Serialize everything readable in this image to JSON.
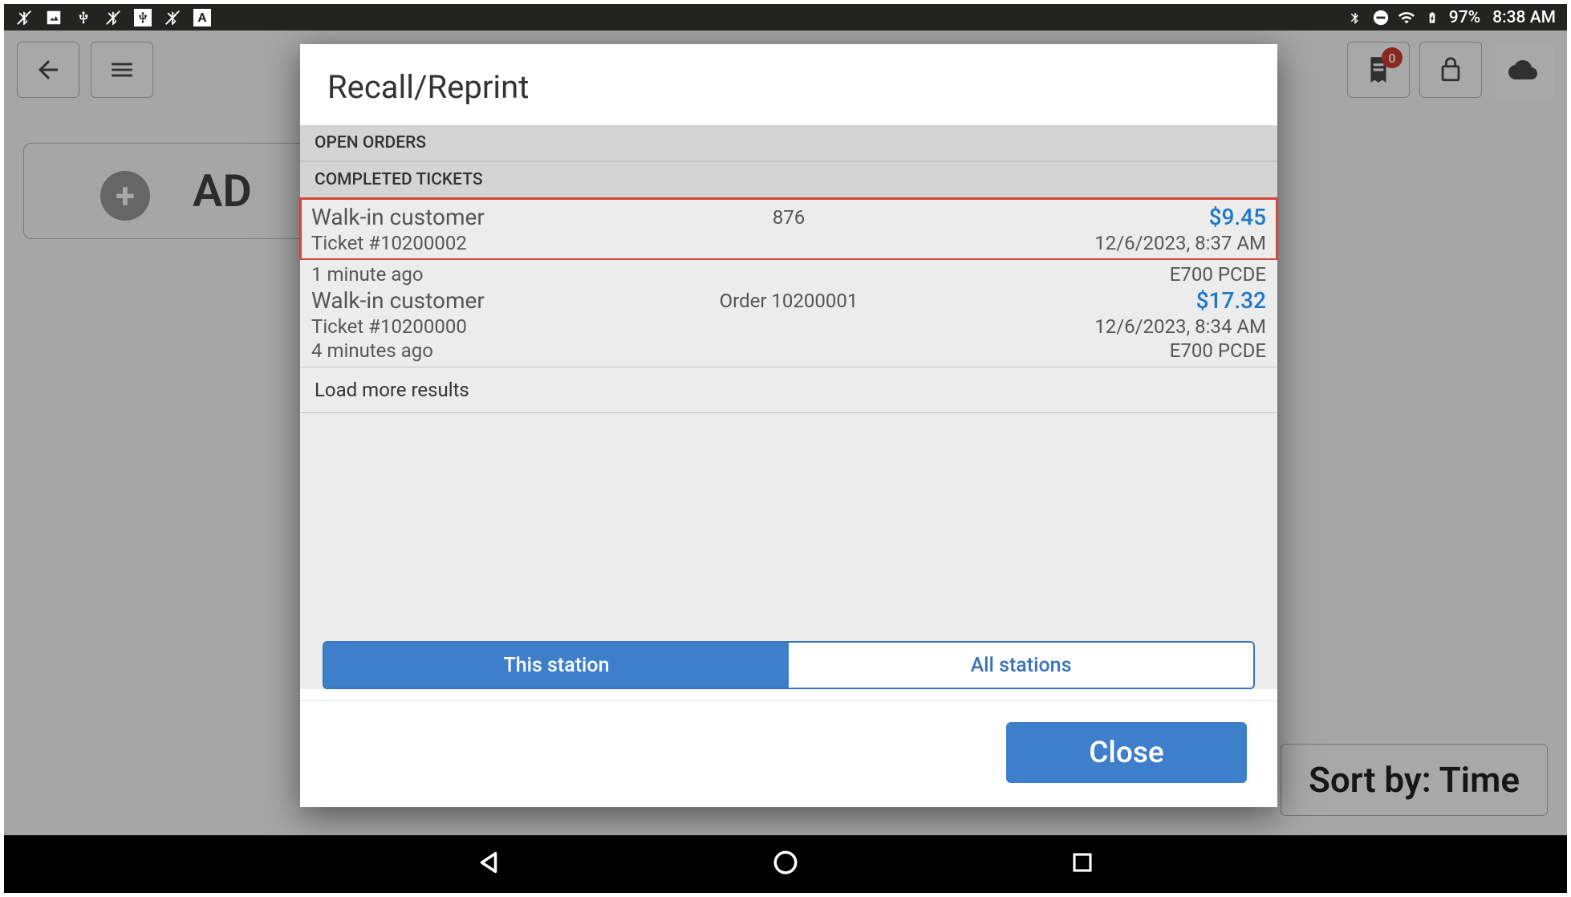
{
  "statusbar": {
    "battery_pct": "97%",
    "time": "8:38 AM"
  },
  "background": {
    "add_label": "AD",
    "sort_label": "Sort by: Time",
    "receipt_badge_count": "0"
  },
  "modal": {
    "title": "Recall/Reprint",
    "open_orders_label": "OPEN ORDERS",
    "completed_label": "COMPLETED TICKETS",
    "tickets": [
      {
        "name": "Walk-in customer",
        "mid": "876",
        "price": "$9.45",
        "ticket_no": "Ticket #10200002",
        "datetime": "12/6/2023, 8:37 AM",
        "elapsed": "1 minute ago",
        "terminal": "E700 PCDE",
        "highlighted": true
      },
      {
        "name": "Walk-in customer",
        "mid": "Order 10200001",
        "price": "$17.32",
        "ticket_no": "Ticket #10200000",
        "datetime": "12/6/2023, 8:34 AM",
        "elapsed": "4 minutes ago",
        "terminal": "E700 PCDE",
        "highlighted": false
      }
    ],
    "load_more_label": "Load more results",
    "this_station_label": "This station",
    "all_stations_label": "All stations",
    "close_label": "Close"
  },
  "navbar": {}
}
